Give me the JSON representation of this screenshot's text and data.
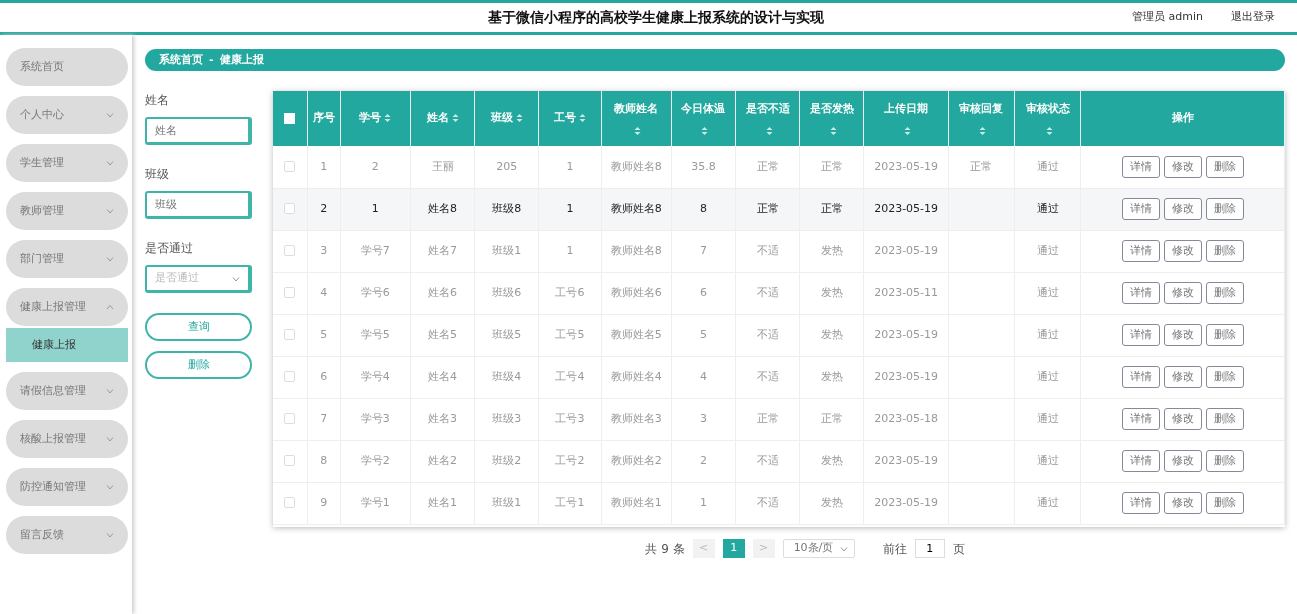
{
  "header": {
    "title": "基于微信小程序的高校学生健康上报系统的设计与实现",
    "user": "管理员 admin",
    "logout": "退出登录"
  },
  "sidebar": {
    "items": [
      {
        "label": "系统首页",
        "has_caret": false
      },
      {
        "label": "个人中心",
        "has_caret": true,
        "expanded": false
      },
      {
        "label": "学生管理",
        "has_caret": true,
        "expanded": false
      },
      {
        "label": "教师管理",
        "has_caret": true,
        "expanded": false
      },
      {
        "label": "部门管理",
        "has_caret": true,
        "expanded": false
      },
      {
        "label": "健康上报管理",
        "has_caret": true,
        "expanded": true,
        "children": [
          {
            "label": "健康上报",
            "selected": true
          }
        ]
      },
      {
        "label": "请假信息管理",
        "has_caret": true,
        "expanded": false
      },
      {
        "label": "核酸上报管理",
        "has_caret": true,
        "expanded": false
      },
      {
        "label": "防控通知管理",
        "has_caret": true,
        "expanded": false
      },
      {
        "label": "留言反馈",
        "has_caret": true,
        "expanded": false
      }
    ]
  },
  "breadcrumb": [
    "系统首页",
    "-",
    "健康上报"
  ],
  "filters": [
    {
      "kind": "input",
      "label": "姓名",
      "placeholder": "姓名"
    },
    {
      "kind": "input",
      "label": "班级",
      "placeholder": "班级"
    },
    {
      "kind": "select",
      "label": "是否通过",
      "placeholder": "是否通过"
    }
  ],
  "filter_buttons": [
    "查询",
    "删除"
  ],
  "table": {
    "select_all_checked": false,
    "columns": [
      {
        "label": "序号",
        "sortable": false
      },
      {
        "label": "学号",
        "sortable": true
      },
      {
        "label": "姓名",
        "sortable": true
      },
      {
        "label": "班级",
        "sortable": true
      },
      {
        "label": "工号",
        "sortable": true
      },
      {
        "label": "教师姓名",
        "sortable": true
      },
      {
        "label": "今日体温",
        "sortable": true
      },
      {
        "label": "是否不适",
        "sortable": true
      },
      {
        "label": "是否发热",
        "sortable": true
      },
      {
        "label": "上传日期",
        "sortable": true
      },
      {
        "label": "审核回复",
        "sortable": true
      },
      {
        "label": "审核状态",
        "sortable": true
      },
      {
        "label": "操作",
        "sortable": false
      }
    ],
    "rows": [
      {
        "checked": false,
        "highlighted": false,
        "cells": [
          "1",
          "2",
          "王丽",
          "205",
          "1",
          "教师姓名8",
          "35.8",
          "正常",
          "正常",
          "2023-05-19",
          "正常",
          "通过"
        ],
        "actions": [
          "详情",
          "修改",
          "删除"
        ]
      },
      {
        "checked": false,
        "highlighted": true,
        "cells": [
          "2",
          "1",
          "姓名8",
          "班级8",
          "1",
          "教师姓名8",
          "8",
          "正常",
          "正常",
          "2023-05-19",
          "",
          "通过"
        ],
        "actions": [
          "详情",
          "修改",
          "删除"
        ]
      },
      {
        "checked": false,
        "highlighted": false,
        "cells": [
          "3",
          "学号7",
          "姓名7",
          "班级1",
          "1",
          "教师姓名8",
          "7",
          "不适",
          "发热",
          "2023-05-19",
          "",
          "通过"
        ],
        "actions": [
          "详情",
          "修改",
          "删除"
        ]
      },
      {
        "checked": false,
        "highlighted": false,
        "cells": [
          "4",
          "学号6",
          "姓名6",
          "班级6",
          "工号6",
          "教师姓名6",
          "6",
          "不适",
          "发热",
          "2023-05-11",
          "",
          "通过"
        ],
        "actions": [
          "详情",
          "修改",
          "删除"
        ]
      },
      {
        "checked": false,
        "highlighted": false,
        "cells": [
          "5",
          "学号5",
          "姓名5",
          "班级5",
          "工号5",
          "教师姓名5",
          "5",
          "不适",
          "发热",
          "2023-05-19",
          "",
          "通过"
        ],
        "actions": [
          "详情",
          "修改",
          "删除"
        ]
      },
      {
        "checked": false,
        "highlighted": false,
        "cells": [
          "6",
          "学号4",
          "姓名4",
          "班级4",
          "工号4",
          "教师姓名4",
          "4",
          "不适",
          "发热",
          "2023-05-19",
          "",
          "通过"
        ],
        "actions": [
          "详情",
          "修改",
          "删除"
        ]
      },
      {
        "checked": false,
        "highlighted": false,
        "cells": [
          "7",
          "学号3",
          "姓名3",
          "班级3",
          "工号3",
          "教师姓名3",
          "3",
          "正常",
          "正常",
          "2023-05-18",
          "",
          "通过"
        ],
        "actions": [
          "详情",
          "修改",
          "删除"
        ]
      },
      {
        "checked": false,
        "highlighted": false,
        "cells": [
          "8",
          "学号2",
          "姓名2",
          "班级2",
          "工号2",
          "教师姓名2",
          "2",
          "不适",
          "发热",
          "2023-05-19",
          "",
          "通过"
        ],
        "actions": [
          "详情",
          "修改",
          "删除"
        ]
      },
      {
        "checked": false,
        "highlighted": false,
        "cells": [
          "9",
          "学号1",
          "姓名1",
          "班级1",
          "工号1",
          "教师姓名1",
          "1",
          "不适",
          "发热",
          "2023-05-19",
          "",
          "通过"
        ],
        "actions": [
          "详情",
          "修改",
          "删除"
        ]
      }
    ]
  },
  "pagination": {
    "total": "共 9 条",
    "prev": "<",
    "pages": [
      {
        "label": "1",
        "selected": true
      }
    ],
    "next": ">",
    "page_size": "10条/页",
    "goto_label": "前往",
    "goto_value": "1",
    "goto_suffix": "页"
  }
}
